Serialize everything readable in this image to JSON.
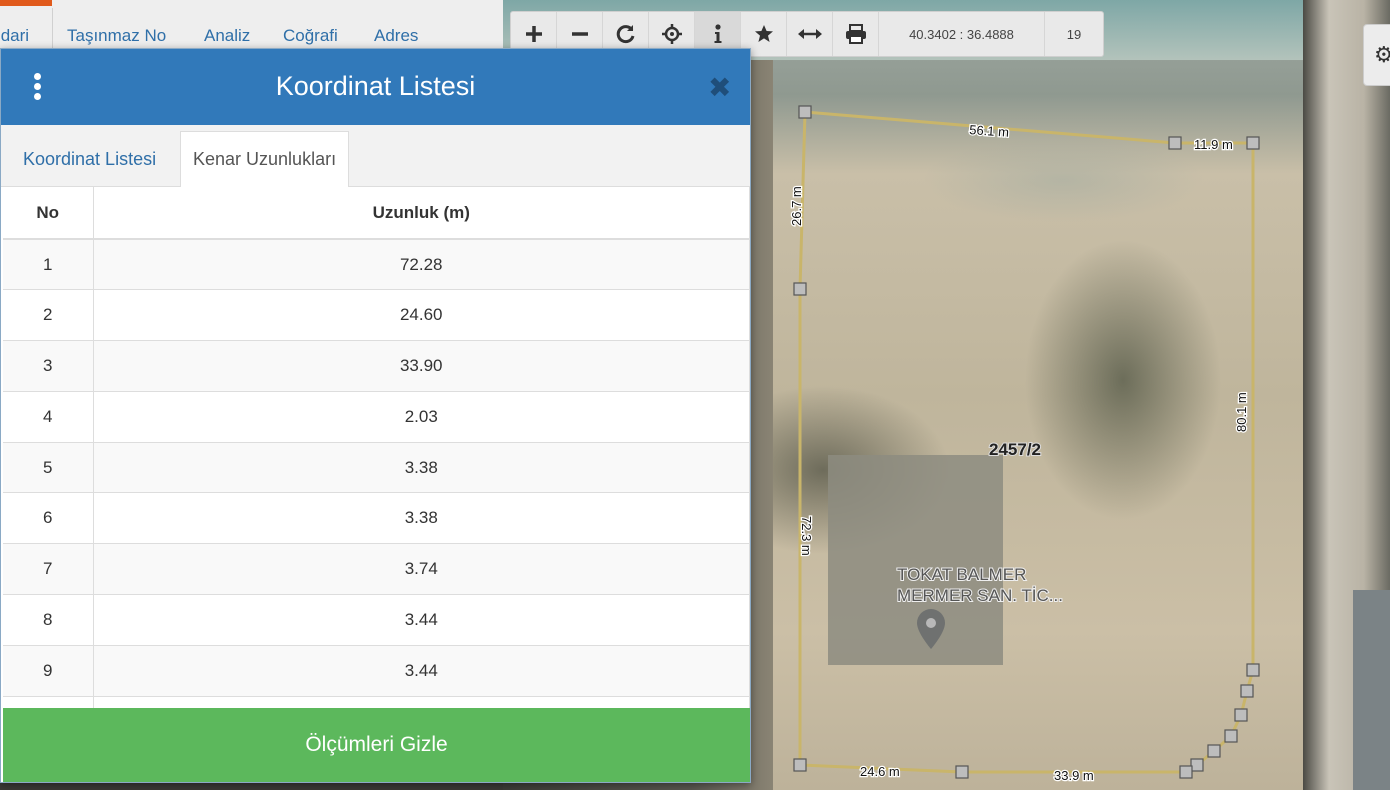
{
  "nav": {
    "items": [
      "İdari",
      "Taşınmaz No",
      "Analiz",
      "Coğrafi",
      "Adres"
    ]
  },
  "toolbar": {
    "buttons": [
      "zoom-in-icon",
      "zoom-out-icon",
      "refresh-icon",
      "locate-icon",
      "info-icon",
      "star-icon",
      "measure-icon",
      "print-icon"
    ],
    "active": "info-icon",
    "coordinates": "40.3402 : 36.4888",
    "zoom": "19"
  },
  "map": {
    "parcel_label": "2457/2",
    "place_label_1": "TOKAT BALMER",
    "place_label_2": "MERMER SAN. TİC...",
    "edge_labels": [
      "56.1 m",
      "11.9 m",
      "26.7 m",
      "80.1 m",
      "72.3 m",
      "24.6 m",
      "33.9 m"
    ]
  },
  "modal": {
    "title": "Koordinat Listesi",
    "close": "✖",
    "tabs": [
      "Koordinat Listesi",
      "Kenar Uzunlukları"
    ],
    "active_tab": "Kenar Uzunlukları",
    "columns": [
      "No",
      "Uzunluk (m)"
    ],
    "rows": [
      [
        "1",
        "72.28"
      ],
      [
        "2",
        "24.60"
      ],
      [
        "3",
        "33.90"
      ],
      [
        "4",
        "2.03"
      ],
      [
        "5",
        "3.38"
      ],
      [
        "6",
        "3.38"
      ],
      [
        "7",
        "3.74"
      ],
      [
        "8",
        "3.44"
      ],
      [
        "9",
        "3.44"
      ],
      [
        "",
        ""
      ]
    ],
    "footer_button": "Ölçümleri Gizle"
  },
  "colors": {
    "header": "#3179ba",
    "footer_button": "#5cb85c",
    "nav_link": "#2f6fa8",
    "parcel_outline": "#c9b56a"
  }
}
